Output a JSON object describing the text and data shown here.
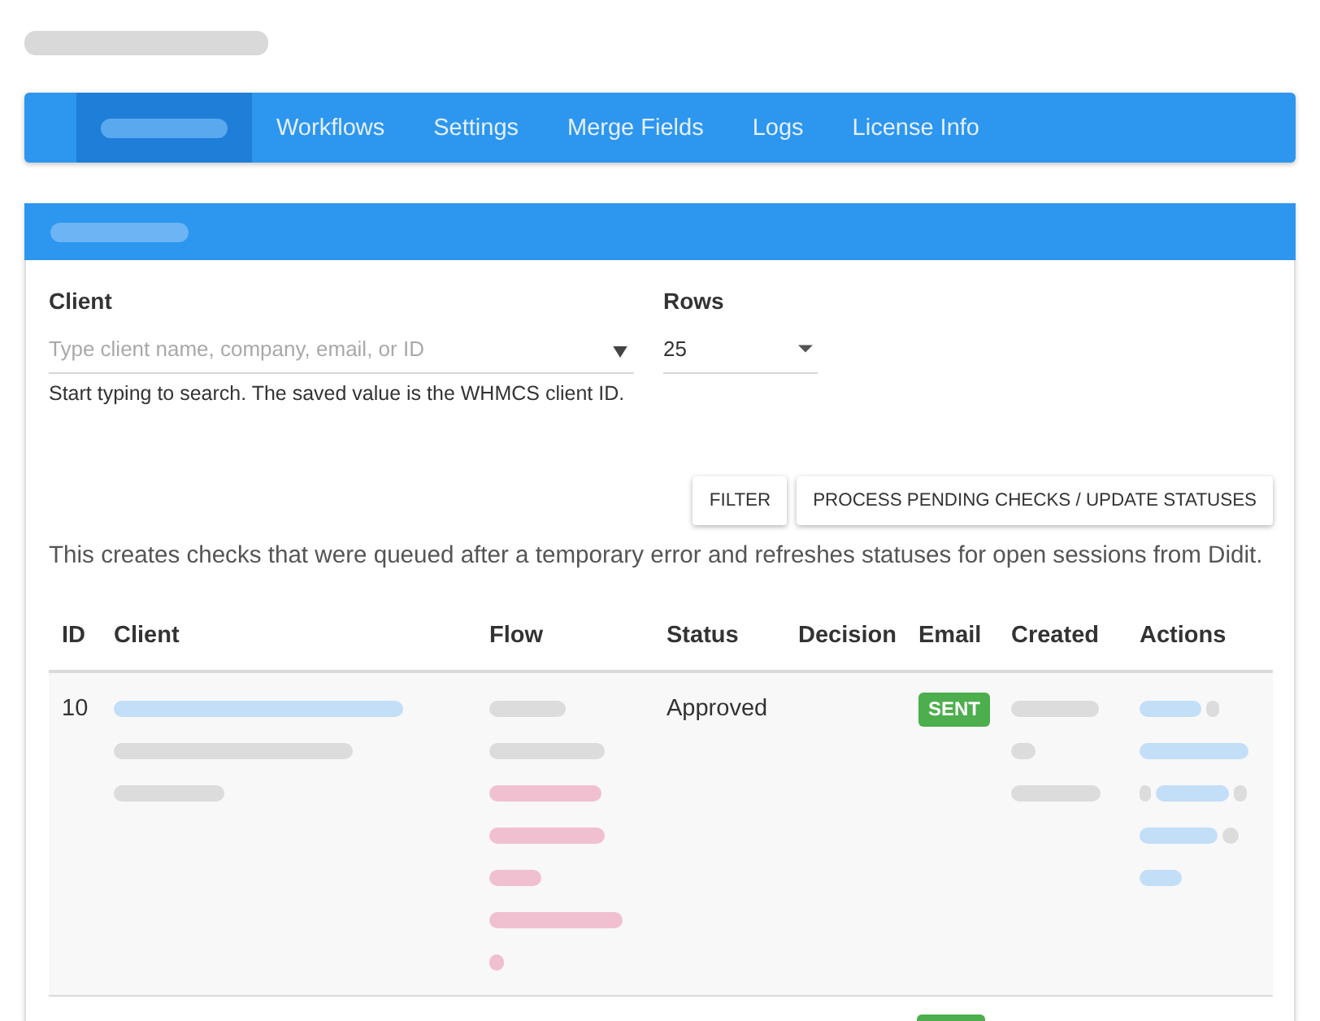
{
  "page_title": {
    "kind": "redacted"
  },
  "tabs": [
    {
      "kind": "redacted",
      "selected": true
    },
    {
      "kind": "text",
      "label": "Workflows",
      "selected": false
    },
    {
      "kind": "text",
      "label": "Settings",
      "selected": false
    },
    {
      "kind": "text",
      "label": "Merge Fields",
      "selected": false
    },
    {
      "kind": "text",
      "label": "Logs",
      "selected": false
    },
    {
      "kind": "text",
      "label": "License Info",
      "selected": false
    }
  ],
  "panel": {
    "header": {
      "kind": "redacted"
    },
    "client_filter": {
      "label": "Client",
      "placeholder": "Type client name, company, email, or ID",
      "hint": "Start typing to search. The saved value is the WHMCS client ID."
    },
    "rows_filter": {
      "label": "Rows",
      "value": "25"
    },
    "buttons": [
      "FILTER",
      "PROCESS PENDING CHECKS / UPDATE STATUSES"
    ],
    "note": "This creates checks that were queued after a temporary error and refreshes statuses for open sessions from Didit.",
    "table": {
      "columns": [
        "ID",
        "Client",
        "Flow",
        "Status",
        "Decision",
        "Email",
        "Created",
        "Actions"
      ],
      "rows": [
        {
          "id": "10",
          "client": [
            {
              "kind": "redacted-link"
            },
            {
              "kind": "redacted-text"
            },
            {
              "kind": "redacted-text"
            }
          ],
          "flow": [
            {
              "kind": "redacted-text"
            },
            {
              "kind": "redacted-text"
            },
            {
              "kind": "redacted-alert"
            },
            {
              "kind": "redacted-alert"
            },
            {
              "kind": "redacted-alert"
            },
            {
              "kind": "redacted-alert"
            },
            {
              "kind": "redacted-alert"
            }
          ],
          "status": "Approved",
          "email": {
            "kind": "success",
            "label": "SENT"
          },
          "created": [
            {
              "kind": "redacted-text"
            },
            {
              "kind": "redacted-text"
            },
            {
              "kind": "redacted-text"
            }
          ],
          "actions": [
            [
              {
                "kind": "redacted-link"
              },
              {
                "kind": "redacted-text"
              }
            ],
            [
              {
                "kind": "redacted-link"
              }
            ],
            [
              {
                "kind": "redacted-text"
              },
              {
                "kind": "redacted-link"
              },
              {
                "kind": "redacted-text"
              }
            ],
            [
              {
                "kind": "redacted-link"
              },
              {
                "kind": "redacted-text"
              }
            ],
            [
              {
                "kind": "redacted-link"
              }
            ]
          ]
        },
        {
          "email": {
            "kind": "success"
          }
        }
      ]
    }
  }
}
